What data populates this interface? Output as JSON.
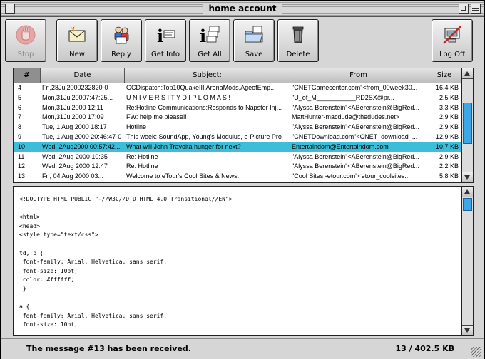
{
  "window": {
    "title": "home account"
  },
  "toolbar": {
    "buttons": [
      {
        "label": "Stop",
        "icon": "stop-hand-icon",
        "enabled": false
      },
      {
        "label": "New",
        "icon": "new-envelope-icon",
        "enabled": true
      },
      {
        "label": "Reply",
        "icon": "reply-people-icon",
        "enabled": true
      },
      {
        "label": "Get Info",
        "icon": "info-icon",
        "enabled": true
      },
      {
        "label": "Get All",
        "icon": "get-all-icon",
        "enabled": true
      },
      {
        "label": "Save",
        "icon": "save-folder-icon",
        "enabled": true
      },
      {
        "label": "Delete",
        "icon": "trash-icon",
        "enabled": true
      },
      {
        "label": "Log Off",
        "icon": "log-off-icon",
        "enabled": true
      }
    ]
  },
  "messages": {
    "columns": [
      "#",
      "Date",
      "Subject:",
      "From",
      "Size"
    ],
    "sorted_column": "#",
    "selected_index": 6,
    "rows": [
      {
        "num": "4",
        "date": "Fri,28Jul2000232820-0",
        "subject": "GCDispatch:Top10QuakeIII ArenaMods,AgeofEmp...",
        "from": "\"CNETGamecenter.com\"<from_00week30...",
        "size": "16.4 KB"
      },
      {
        "num": "5",
        "date": "Mon,31Jul20007:47:25...",
        "subject": "U N I V E R S I T Y D I P L O M A S !",
        "from": "\"U_of_M___________RD2SX@pr...",
        "size": "2.5 KB"
      },
      {
        "num": "6",
        "date": "Mon,31Jul2000 12:11",
        "subject": "Re:Hotline Communications:Responds to Napster Inj...",
        "from": "\"Alyssa Berenstein\"<ABerenstein@BigRed...",
        "size": "3.3 KB"
      },
      {
        "num": "7",
        "date": "Mon,31Jul2000 17:09",
        "subject": "FW: help me please!!",
        "from": "MattHunter-macdude@thedudes.net>",
        "size": "2.9 KB"
      },
      {
        "num": "8",
        "date": "Tue, 1 Aug 2000 18:17",
        "subject": "Hotline",
        "from": "\"Alyssa Berenstein\"<ABerenstein@BigRed...",
        "size": "2.9 KB"
      },
      {
        "num": "9",
        "date": "Tue, 1 Aug 2000 20:46:47-0",
        "subject": "This week: SoundApp, Young's Modulus, e-Picture Pro",
        "from": "\"CNETDownload.com\"<CNET_download_...",
        "size": "12.9 KB"
      },
      {
        "num": "10",
        "date": "Wed, 2Aug2000 00:57:42...",
        "subject": "What will John Travolta hunger for next?",
        "from": "Entertaindom@Entertaindom.com",
        "size": "10.7 KB"
      },
      {
        "num": "11",
        "date": "Wed, 2Aug 2000 10:35",
        "subject": "Re: Hotline",
        "from": "\"Alyssa Berenstein\"<ABerenstein@BigRed...",
        "size": "2.9 KB"
      },
      {
        "num": "12",
        "date": "Wed, 2Aug 2000 12:47",
        "subject": "Re: Hotline",
        "from": "\"Alyssa Berenstein\"<ABerenstein@BigRed...",
        "size": "2.2 KB"
      },
      {
        "num": "13",
        "date": "Fri, 04 Aug 2000 03...",
        "subject": "Welcome to eTour's Cool Sites & News.",
        "from": "\"Cool Sites -etour.com\"<etour_coolsites...",
        "size": "5.8 KB"
      }
    ]
  },
  "preview": {
    "lines": [
      "<!DOCTYPE HTML PUBLIC \"-//W3C//DTD HTML 4.0 Transitional//EN\">",
      "",
      "<html>",
      "<head>",
      "<style type=\"text/css\">",
      "",
      "td, p {",
      " font-family: Arial, Helvetica, sans serif,",
      " font-size: 10pt;",
      " color: #ffffff;",
      " }",
      "",
      "a {",
      " font-family: Arial, Helvetica, sans serif,",
      " font-size: 10pt;"
    ]
  },
  "status": {
    "message": "The message #13 has been received.",
    "count": "13 / 402.5 KB"
  },
  "colors": {
    "selected_row": "#3dbed8",
    "scroll_thumb": "#3aa7e8"
  }
}
